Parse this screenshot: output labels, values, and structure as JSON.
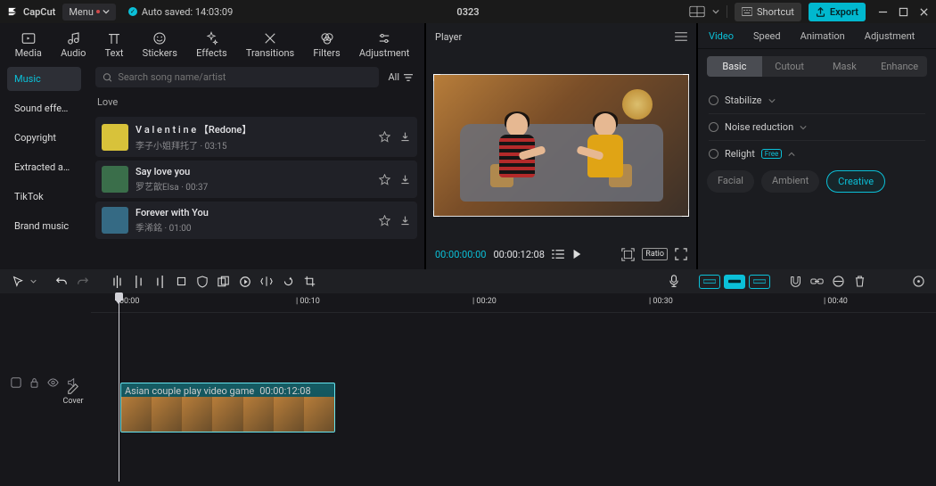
{
  "titlebar": {
    "logo": "CapCut",
    "menu": "Menu",
    "autosaved": "Auto saved: 14:03:09",
    "project": "0323",
    "shortcut": "Shortcut",
    "export": "Export"
  },
  "leftTabs": [
    {
      "id": "media",
      "label": "Media"
    },
    {
      "id": "audio",
      "label": "Audio"
    },
    {
      "id": "text",
      "label": "Text"
    },
    {
      "id": "stickers",
      "label": "Stickers"
    },
    {
      "id": "effects",
      "label": "Effects"
    },
    {
      "id": "transitions",
      "label": "Transitions"
    },
    {
      "id": "filters",
      "label": "Filters"
    },
    {
      "id": "adjustment",
      "label": "Adjustment"
    }
  ],
  "leftTabsActive": "audio",
  "sidenav": [
    "Music",
    "Sound effe…",
    "Copyright",
    "Extracted a…",
    "TikTok",
    "Brand music"
  ],
  "sidenavActive": 0,
  "search": {
    "placeholder": "Search song name/artist",
    "filterAll": "All"
  },
  "listCategory": "Love",
  "songs": [
    {
      "title": "V a l e n t i n e 【Redone】",
      "sub": "李子小姐拜托了 · 03:15",
      "art": "#d8c23a"
    },
    {
      "title": "Say love you",
      "sub": "罗艺歆Elsa · 00:37",
      "art": "#3a6e4a"
    },
    {
      "title": "Forever with You",
      "sub": "季浠銘 · 01:00",
      "art": "#356a84"
    }
  ],
  "player": {
    "title": "Player",
    "time": "00:00:00:00",
    "dur": "00:00:12:08",
    "ratio": "Ratio"
  },
  "props": {
    "tabs": [
      "Video",
      "Speed",
      "Animation",
      "Adjustment"
    ],
    "tabsActive": 0,
    "subtabs": [
      "Basic",
      "Cutout",
      "Mask",
      "Enhance"
    ],
    "subtabsActive": 0,
    "stabilize": "Stabilize",
    "noise": "Noise reduction",
    "relight": "Relight",
    "relightBadge": "Free",
    "chips": [
      "Facial",
      "Ambient",
      "Creative"
    ],
    "chipsActive": 2
  },
  "timeline": {
    "ticks": [
      {
        "pos": 32,
        "label": "00:00"
      },
      {
        "pos": 230,
        "label": "| 00:10"
      },
      {
        "pos": 428,
        "label": "| 00:20"
      },
      {
        "pos": 626,
        "label": "| 00:30"
      },
      {
        "pos": 822,
        "label": "| 00:40"
      }
    ],
    "clip": {
      "name": "Asian couple play video game",
      "dur": "00:00:12:08"
    },
    "cover": "Cover"
  }
}
